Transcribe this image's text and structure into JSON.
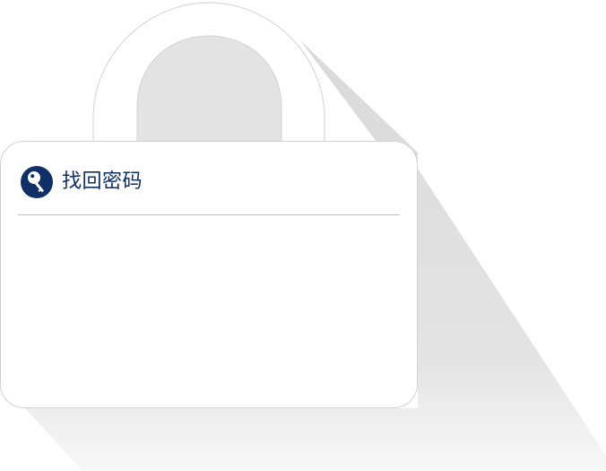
{
  "card": {
    "title": "找回密码",
    "icon": "key-icon"
  },
  "colors": {
    "title": "#0f2f66",
    "icon_badge": "#0f2f66",
    "card_background": "#ffffff",
    "card_border": "#d6d6d6",
    "shackle_inner": "#e3e3e3",
    "shadow": "#dcdcdc",
    "divider": "#bdbdbd"
  }
}
